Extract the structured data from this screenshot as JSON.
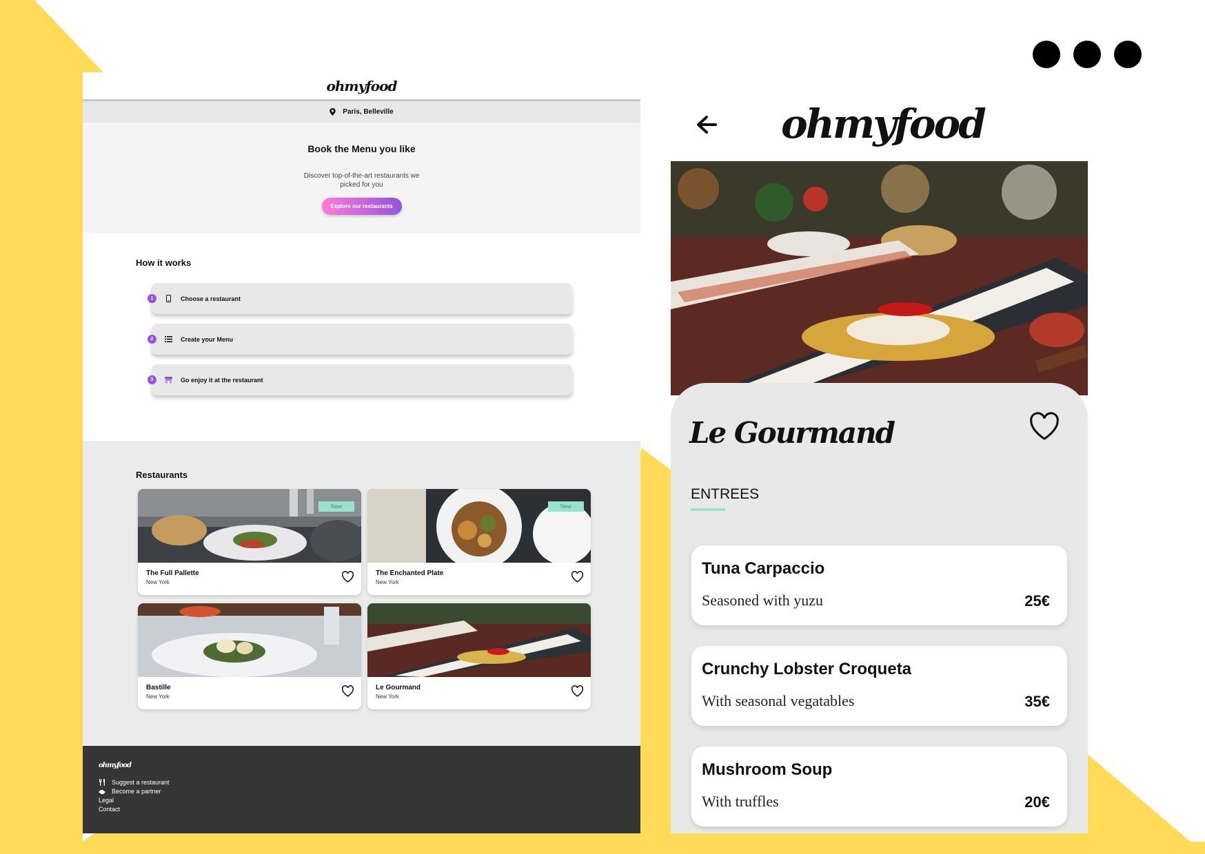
{
  "colors": {
    "background_accent": "#ffdb57",
    "primary_gradient_start": "#ff79da",
    "primary_gradient_end": "#9356dc",
    "secondary": "#99e2d0",
    "footer": "#353535"
  },
  "desktop": {
    "brand": "ohmyfood",
    "location": {
      "icon": "map-pin-icon",
      "text": "Paris, Belleville"
    },
    "hero": {
      "title": "Book the Menu you like",
      "subtitle": "Discover top-of-the-art restaurants we picked for you",
      "button": "Explore our restaurants"
    },
    "how": {
      "title": "How it works",
      "steps": [
        {
          "num": "1",
          "icon": "phone-icon",
          "label": "Choose a restaurant"
        },
        {
          "num": "2",
          "icon": "list-icon",
          "label": "Create your Menu"
        },
        {
          "num": "3",
          "icon": "store-icon",
          "label": "Go enjoy it at the restaurant"
        }
      ]
    },
    "restaurants": {
      "title": "Restaurants",
      "items": [
        {
          "name": "The Full Pallette",
          "city": "New York",
          "badge": "New"
        },
        {
          "name": "The Enchanted Plate",
          "city": "New York",
          "badge": "New"
        },
        {
          "name": "Bastille",
          "city": "New York",
          "badge": ""
        },
        {
          "name": "Le Gourmand",
          "city": "New York",
          "badge": ""
        }
      ]
    },
    "footer": {
      "brand": "ohmyfood",
      "links": [
        {
          "icon": "utensils-icon",
          "label": "Suggest a restaurant"
        },
        {
          "icon": "handshake-icon",
          "label": "Become a partner"
        },
        {
          "icon": "",
          "label": "Legal"
        },
        {
          "icon": "",
          "label": "Contact"
        }
      ]
    }
  },
  "mobile": {
    "brand": "ohmyfood",
    "restaurant_name": "Le Gourmand",
    "section": "ENTREES",
    "dishes": [
      {
        "name": "Tuna Carpaccio",
        "desc": "Seasoned with yuzu",
        "price": "25€"
      },
      {
        "name": "Crunchy Lobster Croqueta",
        "desc": "With seasonal vegatables",
        "price": "35€"
      },
      {
        "name": "Mushroom Soup",
        "desc": "With truffles",
        "price": "20€"
      }
    ]
  }
}
